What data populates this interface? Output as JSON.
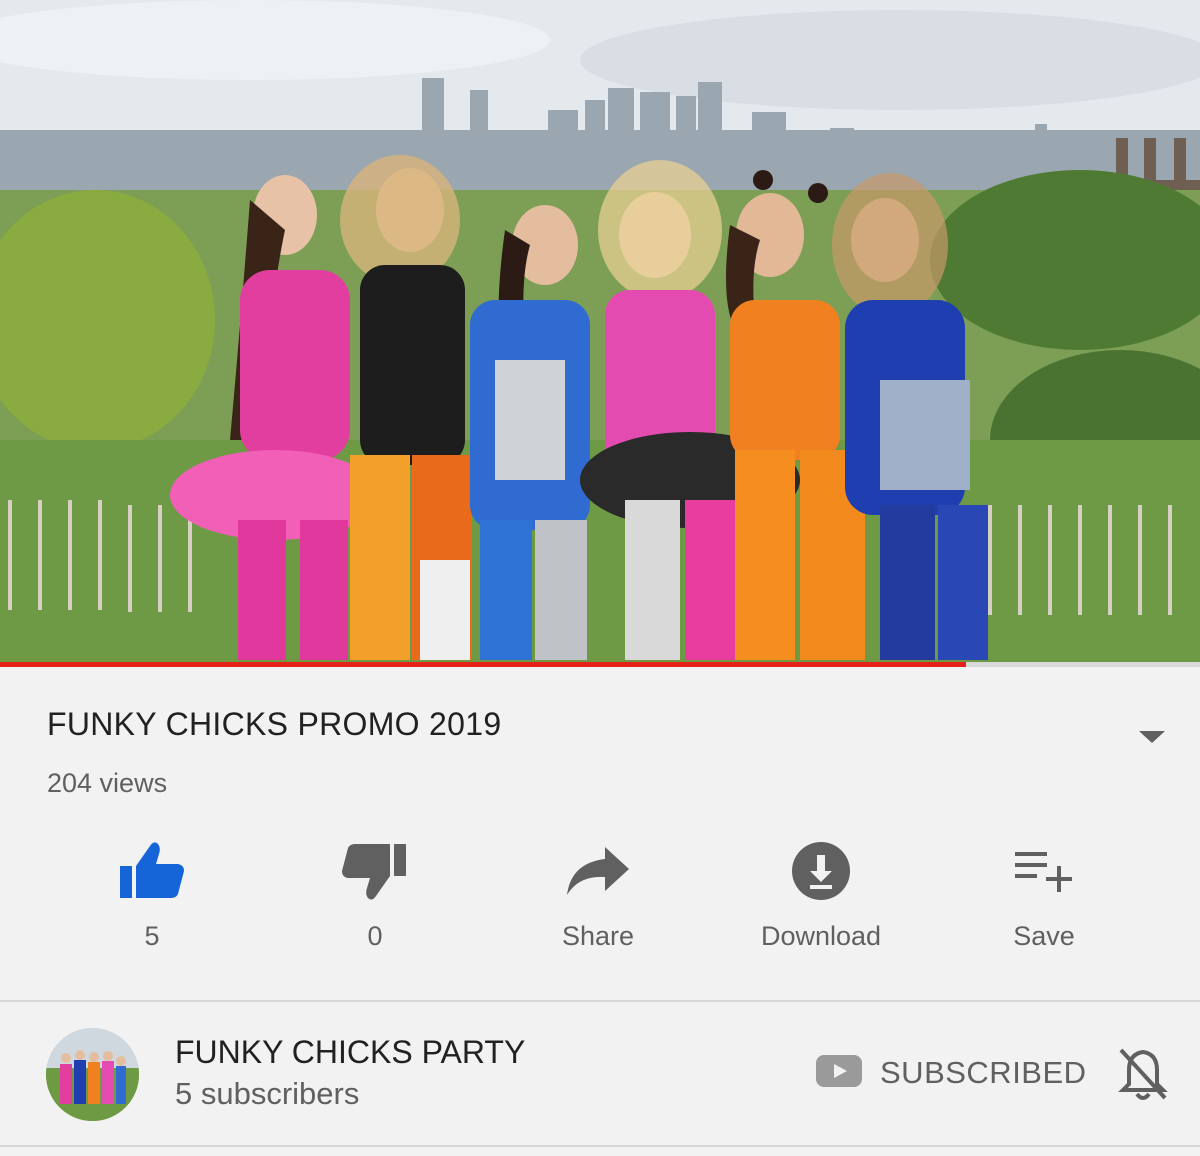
{
  "video": {
    "title": "FUNKY CHICKS PROMO 2019",
    "views": "204 views",
    "progress_fraction": 0.805
  },
  "actions": {
    "like": {
      "icon": "thumbs-up-icon",
      "label": "5",
      "active_color": "#1565d8"
    },
    "dislike": {
      "icon": "thumbs-down-icon",
      "label": "0"
    },
    "share": {
      "icon": "share-arrow-icon",
      "label": "Share"
    },
    "download": {
      "icon": "download-circle-icon",
      "label": "Download"
    },
    "save": {
      "icon": "playlist-add-icon",
      "label": "Save"
    }
  },
  "channel": {
    "name": "FUNKY CHICKS PARTY",
    "subscribers": "5 subscribers",
    "subscribe_label": "SUBSCRIBED",
    "subscribe_icon": "youtube-logo-icon",
    "bell_icon": "bell-off-icon"
  },
  "colors": {
    "progress": "#e62117",
    "like": "#1565d8",
    "icon_gray": "#606060"
  }
}
